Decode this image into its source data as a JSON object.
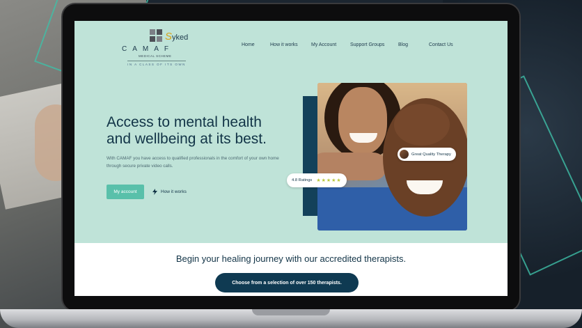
{
  "logo": {
    "brand": "CAMAF",
    "scheme": "MEDICAL SCHEME",
    "tagline": "IN A CLASS OF ITS OWN",
    "partner_initial": "S",
    "partner_rest": "yked"
  },
  "nav": {
    "items": [
      "Home",
      "How it works",
      "My Account",
      "Support Groups",
      "Blog",
      "Contact Us"
    ]
  },
  "hero": {
    "title_line1": "Access to mental health",
    "title_line2": "and wellbeing at its best.",
    "subtitle": "With CAMAF you have access to qualified professionals in the comfort of your own home through secure private video calls.",
    "primary_button": "My account",
    "secondary_link": "How it works"
  },
  "badges": {
    "quality": "Great Quality Therapy",
    "rating": "4.8 Ratings",
    "stars": "★★★★★"
  },
  "band": {
    "title": "Begin your healing journey with our accredited therapists.",
    "button": "Choose from a selection of over 150 therapists."
  },
  "colors": {
    "background_mint": "#bfe3d8",
    "navy": "#123447",
    "accent_teal": "#59c0aa",
    "dark_button": "#0f3a52"
  }
}
